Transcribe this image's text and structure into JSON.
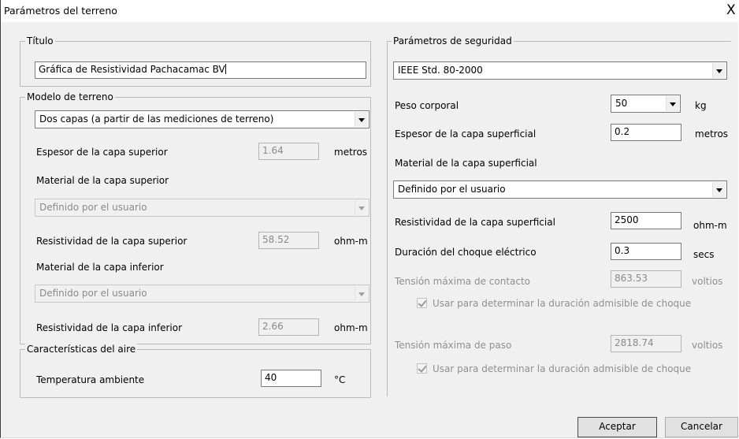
{
  "window": {
    "title": "Parámetros del terreno",
    "close_glyph": "X"
  },
  "titulo": {
    "legend": "Título",
    "value": "Gráfica de Resistividad Pachacamac BV"
  },
  "modelo": {
    "legend": "Modelo de terreno",
    "model_selected": "Dos capas (a partir de las mediciones de terreno)",
    "espesor_superior": {
      "label": "Espesor de la capa superior",
      "value": "1.64",
      "unit": "metros"
    },
    "material_superior": {
      "label": "Material de la capa superior",
      "selected": "Definido por el usuario"
    },
    "resistividad_superior": {
      "label": "Resistividad de la capa superior",
      "value": "58.52",
      "unit": "ohm-m"
    },
    "material_inferior": {
      "label": "Material de la capa inferior",
      "selected": "Definido por el usuario"
    },
    "resistividad_inferior": {
      "label": "Resistividad de la capa inferior",
      "value": "2.66",
      "unit": "ohm-m"
    }
  },
  "aire": {
    "legend": "Características del aire",
    "temperatura": {
      "label": "Temperatura ambiente",
      "value": "40",
      "unit": "°C"
    }
  },
  "seguridad": {
    "legend": "Parámetros de seguridad",
    "standard_selected": "IEEE Std. 80-2000",
    "peso": {
      "label": "Peso corporal",
      "value": "50",
      "unit": "kg"
    },
    "espesor": {
      "label": "Espesor de la capa superficial",
      "value": "0.2",
      "unit": "metros"
    },
    "material": {
      "label": "Material de la capa superficial",
      "selected": "Definido por el usuario"
    },
    "resistividad": {
      "label": "Resistividad de la capa superficial",
      "value": "2500",
      "unit": "ohm-m"
    },
    "duracion": {
      "label": "Duración del choque eléctrico",
      "value": "0.3",
      "unit": "secs"
    },
    "tension_contacto": {
      "label": "Tensión máxima de contacto",
      "value": "863.53",
      "unit": "voltios"
    },
    "check_contacto": {
      "label": "Usar para determinar la duración admisible de choque",
      "checked": true
    },
    "tension_paso": {
      "label": "Tensión máxima de paso",
      "value": "2818.74",
      "unit": "voltios"
    },
    "check_paso": {
      "label": "Usar para determinar la duración admisible de choque",
      "checked": true
    }
  },
  "buttons": {
    "accept": "Aceptar",
    "cancel": "Cancelar"
  }
}
